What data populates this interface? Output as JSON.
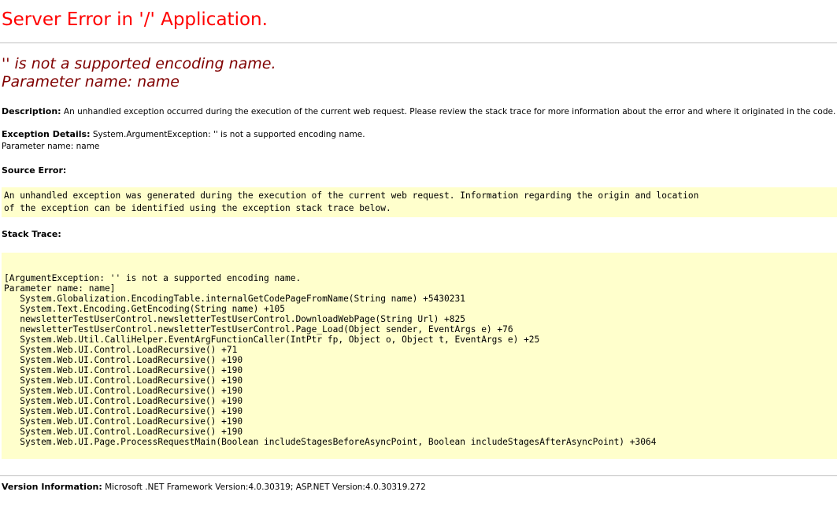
{
  "page": {
    "title": "Server Error in '/' Application.",
    "error_message_line1": "'' is not a supported encoding name.",
    "error_message_line2": "Parameter name: name"
  },
  "description": {
    "label": "Description:",
    "text": "An unhandled exception occurred during the execution of the current web request. Please review the stack trace for more information about the error and where it originated in the code."
  },
  "exception_details": {
    "label": "Exception Details:",
    "text": "System.ArgumentException: '' is not a supported encoding name.",
    "text_line2": "Parameter name: name"
  },
  "source_error": {
    "label": "Source Error:",
    "lines": [
      "An unhandled exception was generated during the execution of the current web request. Information regarding the origin and location",
      "of the exception can be identified using the exception stack trace below."
    ]
  },
  "stack_trace": {
    "label": "Stack Trace:",
    "lines": [
      "[ArgumentException: '' is not a supported encoding name.",
      "Parameter name: name]",
      "   System.Globalization.EncodingTable.internalGetCodePageFromName(String name) +5430231",
      "   System.Text.Encoding.GetEncoding(String name) +105",
      "   newsletterTestUserControl.newsletterTestUserControl.DownloadWebPage(String Url) +825",
      "   newsletterTestUserControl.newsletterTestUserControl.Page_Load(Object sender, EventArgs e) +76",
      "   System.Web.Util.CalliHelper.EventArgFunctionCaller(IntPtr fp, Object o, Object t, EventArgs e) +25",
      "   System.Web.UI.Control.LoadRecursive() +71",
      "   System.Web.UI.Control.LoadRecursive() +190",
      "   System.Web.UI.Control.LoadRecursive() +190",
      "   System.Web.UI.Control.LoadRecursive() +190",
      "   System.Web.UI.Control.LoadRecursive() +190",
      "   System.Web.UI.Control.LoadRecursive() +190",
      "   System.Web.UI.Control.LoadRecursive() +190",
      "   System.Web.UI.Control.LoadRecursive() +190",
      "   System.Web.UI.Control.LoadRecursive() +190",
      "   System.Web.UI.Page.ProcessRequestMain(Boolean includeStagesBeforeAsyncPoint, Boolean includeStagesAfterAsyncPoint) +3064"
    ]
  },
  "version_information": {
    "label": "Version Information:",
    "text": "Microsoft .NET Framework Version:4.0.30319; ASP.NET Version:4.0.30319.272"
  },
  "colors": {
    "title": "#ff0000",
    "error_message": "#800000",
    "code_background": "#ffffcc",
    "rule": "#c0c0c0"
  }
}
